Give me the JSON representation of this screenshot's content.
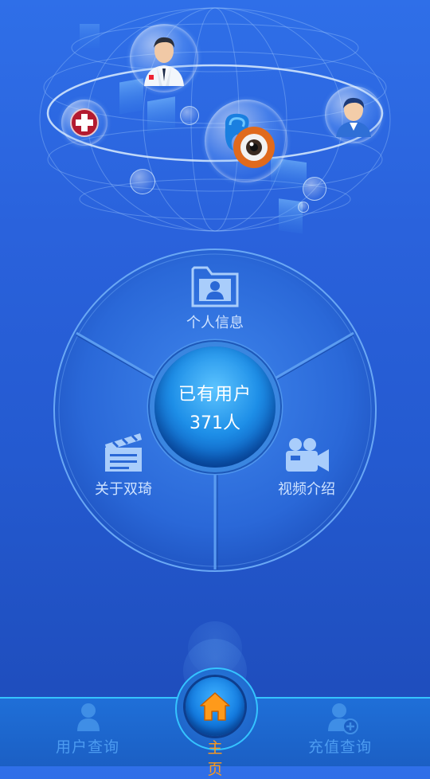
{
  "dial": {
    "center_title": "已有用户",
    "center_count": "371人",
    "segments": {
      "personal_info": "个人信息",
      "about": "关于双琦",
      "video": "视频介绍"
    }
  },
  "nav": {
    "user_query": "用户查询",
    "home": "主 页",
    "recharge_query": "充值查询"
  },
  "colors": {
    "background": "#2a62dc",
    "accent": "#35c3ff",
    "home_active": "#ff9a1a",
    "nav_inactive": "#4c9bf0"
  },
  "icons": [
    "doctor-icon",
    "medical-cross-icon",
    "camera-eye-icon",
    "user-avatar-icon",
    "folder-user-icon",
    "clapperboard-icon",
    "video-camera-icon",
    "user-icon",
    "home-icon",
    "user-add-icon"
  ]
}
